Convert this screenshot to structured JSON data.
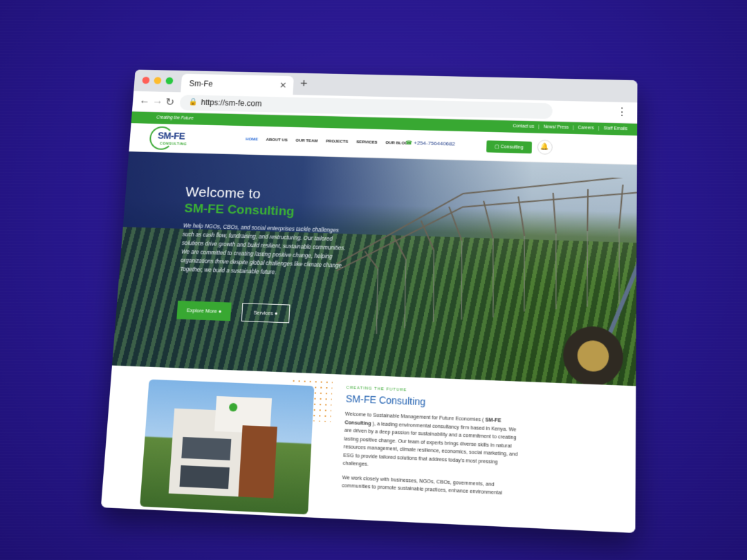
{
  "browser": {
    "tab_title": "Sm-Fe",
    "url": "https://sm-fe.com"
  },
  "site": {
    "tagline": "Creating the Future",
    "top_links": [
      "Contact us",
      "News/ Press",
      "Careers",
      "Staff Emails"
    ],
    "logo_name": "SM-FE",
    "logo_sub": "CONSULTING",
    "menu": [
      "HOME",
      "ABOUT US",
      "OUR TEAM",
      "PROJECTS",
      "SERVICES",
      "OUR BLOGS"
    ],
    "phone": "+254-756440682",
    "consulting_btn": "Consulting"
  },
  "hero": {
    "title_line1": "Welcome to",
    "title_line2": "SM-FE Consulting",
    "body": "We help NGOs, CBOs, and social enterprises tackle challenges such as cash flow, fundraising, and restructuring. Our tailored solutions drive growth and build resilient, sustainable communities. We are committed to creating lasting positive change, helping organizations thrive despite global challenges like climate change. Together, we build a sustainable future.",
    "btn_explore": "Explore More",
    "btn_services": "Services"
  },
  "about": {
    "eyebrow": "CREATING THE FUTURE",
    "title": "SM-FE Consulting",
    "para1_a": "Welcome to Sustainable Management for Future Economies ( ",
    "para1_b": "SM-FE Consulting",
    "para1_c": " ), a leading environmental consultancy firm based in Kenya. We are driven by a deep passion for sustainability and a commitment to creating lasting positive change. Our team of experts brings diverse skills in natural resources management, climate resilience, economics, social marketing, and ESG to provide tailored solutions that address today's most pressing challenges.",
    "para2": "We work closely with businesses, NGOs, CBOs, governments, and communities to promote sustainable practices, enhance environmental"
  },
  "colors": {
    "brand_green": "#38a832",
    "brand_blue": "#1f3c88",
    "background": "#2a1d86"
  }
}
